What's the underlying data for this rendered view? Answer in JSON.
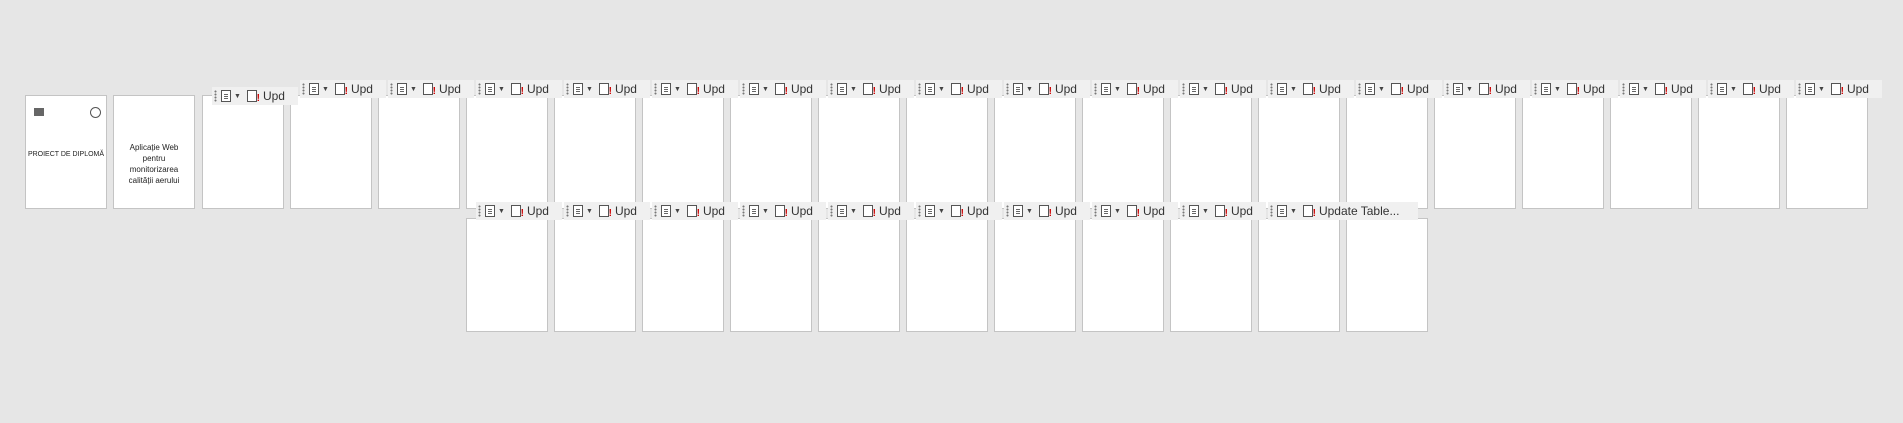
{
  "toolbar": {
    "label_short": "Upd",
    "label_full": "Update Table..."
  },
  "cover": {
    "title": "PROIECT DE DIPLOMĂ"
  },
  "page2": {
    "title": "Aplicație Web pentru monitorizarea calității aerului"
  }
}
